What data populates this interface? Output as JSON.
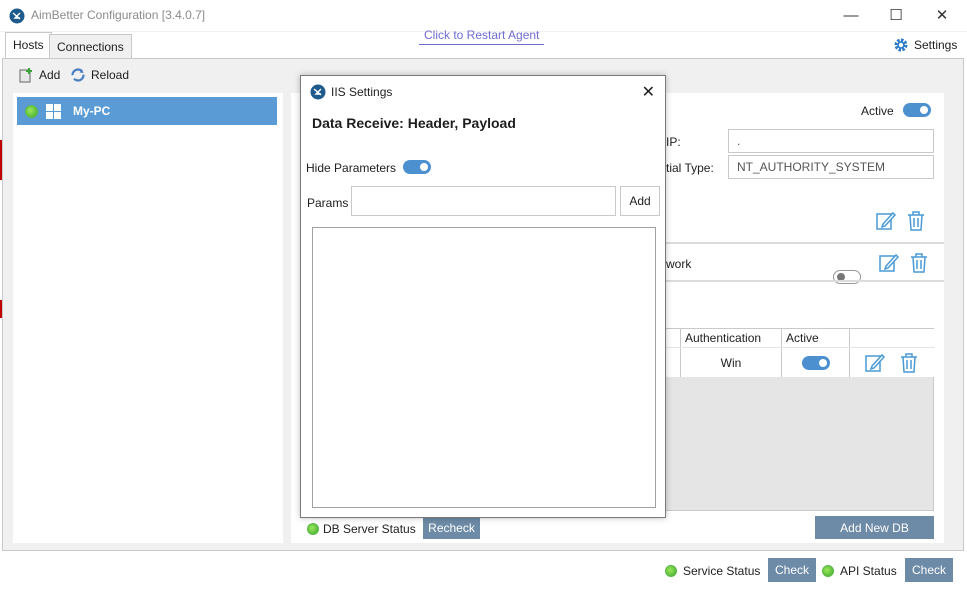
{
  "window": {
    "title": "AimBetter Configuration [3.4.0.7]",
    "controls": {
      "minimize": "—",
      "maximize": "☐",
      "close": "✕"
    }
  },
  "header": {
    "restart_link": "Click to Restart Agent",
    "settings_label": "Settings"
  },
  "tabs": [
    {
      "label": "Hosts",
      "active": true
    },
    {
      "label": "Connections",
      "active": false
    }
  ],
  "toolbar": {
    "add_label": "Add",
    "reload_label": "Reload"
  },
  "hosts": [
    {
      "name": "My-PC",
      "status": "online"
    }
  ],
  "host_details": {
    "active_label": "Active",
    "active": true,
    "ip_label": "IP:",
    "ip_value": ".",
    "credential_label": "tial Type:",
    "credential_value": "NT_AUTHORITY_SYSTEM",
    "network_label": "work",
    "network_enabled": false
  },
  "db_grid": {
    "columns": [
      "Authentication",
      "Active"
    ],
    "rows": [
      {
        "auth": "Win",
        "active": true
      }
    ]
  },
  "db_status": {
    "label": "DB Server Status",
    "recheck_label": "Recheck"
  },
  "add_db_label": "Add New DB",
  "footer": {
    "service_status_label": "Service Status",
    "service_check_label": "Check",
    "api_status_label": "API Status",
    "api_check_label": "Check"
  },
  "modal": {
    "title": "IIS Settings",
    "heading": "Data Receive: Header, Payload",
    "hide_params_label": "Hide Parameters",
    "hide_params": true,
    "params_label": "Params",
    "params_value": "",
    "add_label": "Add",
    "close": "✕"
  },
  "colors": {
    "accent": "#5b9bd5",
    "steel_button": "#6d8aa6",
    "link": "#6f6cd0",
    "status_green": "#4cb93a"
  }
}
